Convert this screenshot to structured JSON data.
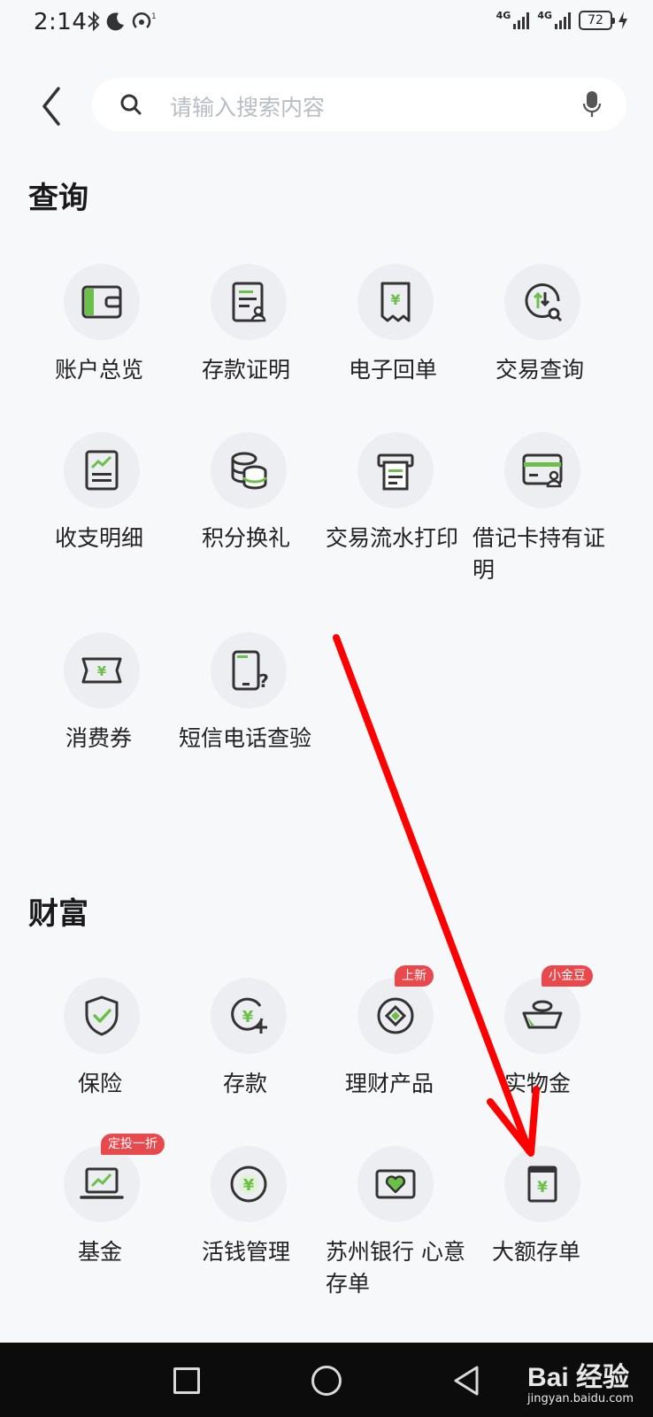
{
  "status_bar": {
    "time": "2:14",
    "network_1": "4G",
    "network_2": "4G",
    "battery": "72"
  },
  "header": {
    "search_placeholder": "请输入搜索内容"
  },
  "sections": {
    "query": {
      "title": "查询",
      "items": [
        {
          "label": "账户总览",
          "icon": "wallet-icon"
        },
        {
          "label": "存款证明",
          "icon": "document-person-icon"
        },
        {
          "label": "电子回单",
          "icon": "receipt-yuan-icon"
        },
        {
          "label": "交易查询",
          "icon": "transaction-search-icon"
        },
        {
          "label": "收支明细",
          "icon": "chart-document-icon"
        },
        {
          "label": "积分换礼",
          "icon": "coins-stack-icon"
        },
        {
          "label": "交易流水打印",
          "icon": "printer-icon"
        },
        {
          "label": "借记卡持有证明",
          "icon": "card-person-icon"
        },
        {
          "label": "消费券",
          "icon": "coupon-icon"
        },
        {
          "label": "短信电话查验",
          "icon": "phone-question-icon"
        }
      ]
    },
    "wealth": {
      "title": "财富",
      "items": [
        {
          "label": "保险",
          "icon": "shield-check-icon"
        },
        {
          "label": "存款",
          "icon": "yuan-plus-icon"
        },
        {
          "label": "理财产品",
          "icon": "diamond-icon",
          "badge": "上新"
        },
        {
          "label": "实物金",
          "icon": "gold-ingot-icon",
          "badge": "小金豆"
        },
        {
          "label": "基金",
          "icon": "laptop-chart-icon",
          "badge": "定投一折"
        },
        {
          "label": "活钱管理",
          "icon": "yuan-circle-icon"
        },
        {
          "label": "苏州银行 心意存单",
          "icon": "heart-card-icon"
        },
        {
          "label": "大额存单",
          "icon": "deposit-certificate-icon"
        }
      ]
    }
  },
  "watermark": {
    "text": "Bai 经验",
    "sub": "jingyan.baidu.com"
  },
  "colors": {
    "accent_green": "#6cc04a",
    "icon_dark": "#333333",
    "badge_red": "#e8494d",
    "annotation_red": "#ff0000"
  }
}
